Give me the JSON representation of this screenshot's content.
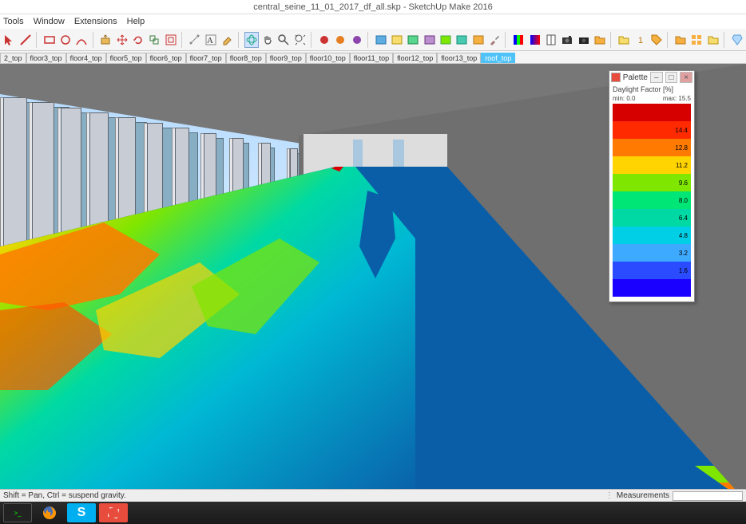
{
  "title": {
    "filename": "central_seine_11_01_2017_df_all.skp",
    "app": "SketchUp Make 2016"
  },
  "menu": {
    "tools": "Tools",
    "window": "Window",
    "extensions": "Extensions",
    "help": "Help"
  },
  "tabs": [
    {
      "label": "2_top"
    },
    {
      "label": "floor3_top"
    },
    {
      "label": "floor4_top"
    },
    {
      "label": "floor5_top"
    },
    {
      "label": "floor6_top"
    },
    {
      "label": "floor7_top"
    },
    {
      "label": "floor8_top"
    },
    {
      "label": "floor9_top"
    },
    {
      "label": "floor10_top"
    },
    {
      "label": "floor11_top"
    },
    {
      "label": "floor12_top"
    },
    {
      "label": "floor13_top"
    },
    {
      "label": "roof_top",
      "active": true
    }
  ],
  "palette": {
    "title": "Palette",
    "subtitle": "Daylight Factor [%]",
    "min_label": "min: 0.0",
    "max_label": "max: 15.5",
    "bands": [
      {
        "v": "",
        "c": "#d60000"
      },
      {
        "v": "14.4",
        "c": "#ff2a00"
      },
      {
        "v": "12.8",
        "c": "#ff7a00"
      },
      {
        "v": "11.2",
        "c": "#ffd400"
      },
      {
        "v": "9.6",
        "c": "#7fe600"
      },
      {
        "v": "8.0",
        "c": "#00e676"
      },
      {
        "v": "6.4",
        "c": "#00d9a3"
      },
      {
        "v": "4.8",
        "c": "#00cfe6"
      },
      {
        "v": "3.2",
        "c": "#3da9ff"
      },
      {
        "v": "1.6",
        "c": "#2a4bff"
      },
      {
        "v": "",
        "c": "#1a00ff"
      }
    ]
  },
  "status": {
    "hint": "Shift = Pan, Ctrl = suspend gravity.",
    "meas": "Measurements"
  },
  "chart_data": {
    "type": "heatmap",
    "title": "Daylight Factor [%]",
    "legend_range": [
      0.0,
      15.5
    ],
    "legend_ticks": [
      1.6,
      3.2,
      4.8,
      6.4,
      8.0,
      9.6,
      11.2,
      12.8,
      14.4
    ],
    "colormap": [
      [
        0.0,
        "#1a00ff"
      ],
      [
        1.6,
        "#2a4bff"
      ],
      [
        3.2,
        "#3da9ff"
      ],
      [
        4.8,
        "#00cfe6"
      ],
      [
        6.4,
        "#00d9a3"
      ],
      [
        8.0,
        "#00e676"
      ],
      [
        9.6,
        "#7fe600"
      ],
      [
        11.2,
        "#ffd400"
      ],
      [
        12.8,
        "#ff7a00"
      ],
      [
        14.4,
        "#ff2a00"
      ],
      [
        15.5,
        "#d60000"
      ]
    ],
    "note": "Floor-plane daylight factor map rendered in 3D perspective; highest values along window wall (left), decreasing toward interior (right)."
  }
}
